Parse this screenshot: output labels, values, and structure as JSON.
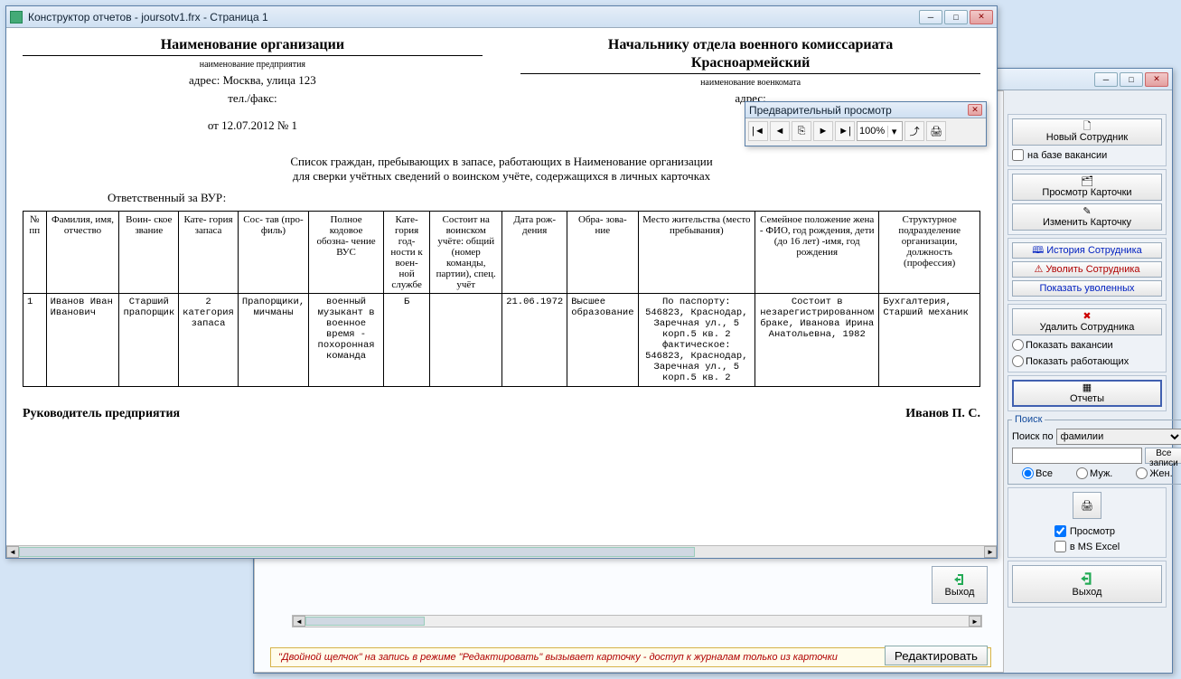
{
  "report_window": {
    "title": "Конструктор отчетов - joursotv1.frx - Страница 1",
    "org_heading": "Наименование организации",
    "org_note": "наименование предприятия",
    "org_addr": "адрес: Москва, улица 123",
    "org_tel": "тел./факс:",
    "org_date": "от 12.07.2012   № 1",
    "recip_heading": "Начальнику отдела военного комиссариата",
    "recip_name": "Красноармейский",
    "recip_note": "наименование военкомата",
    "recip_addr": "адрес:",
    "body_line1": "Список граждан, пребывающих в запасе, работающих в Наименование организации",
    "body_line2": "для сверки учётных сведений о воинском учёте, содержащихся в личных карточках",
    "resp_label": "Ответственный за ВУР:",
    "headers": {
      "c1": "№ пп",
      "c2": "Фамилия, имя, отчество",
      "c3": "Воин- ское звание",
      "c4": "Кате- гория запаса",
      "c5": "Сос- тав (про- филь)",
      "c6": "Полное кодовое обозна- чение ВУС",
      "c7": "Кате- гория год- ности к воен- ной службе",
      "c8": "Состоит на воинском учёте: общий (номер команды, партии), спец. учёт",
      "c9": "Дата рож- дения",
      "c10": "Обра- зова- ние",
      "c11": "Место жительства (место пребывания)",
      "c12": "Семейное положение жена - ФИО, год рождения, дети (до 16 лет) -имя, год рождения",
      "c13": "Структурное подразделение организации, должность (профессия)"
    },
    "row": {
      "c1": "1",
      "c2": "Иванов Иван Иванович",
      "c3": "Старший прапорщик",
      "c4": "2 категория запаса",
      "c5": "Прапорщики, мичманы",
      "c6": "военный музыкант в военное время - похоронная команда",
      "c7": "Б",
      "c8": "",
      "c9": "21.06.1972",
      "c10": "Высшее образование",
      "c11": "По паспорту: 546823, Краснодар, Заречная ул., 5 корп.5 кв. 2 фактическое: 546823, Краснодар, Заречная ул., 5 корп.5 кв. 2",
      "c12": "Состоит в незарегистрированном браке, Иванова Ирина Анатольевна, 1982",
      "c13": "Бухгалтерия, Старший механик"
    },
    "sign_left": "Руководитель предприятия",
    "sign_right": "Иванов П. С."
  },
  "preview_tb": {
    "title": "Предварительный просмотр",
    "zoom": "100%"
  },
  "bgwin": {
    "tip": "\"Двойной щелчок\" на запись в режиме \"Редактировать\" вызывает карточку  -  доступ к журналам только из карточки",
    "edit_btn": "Редактировать",
    "exit_btn": "Выход"
  },
  "side": {
    "new_emp": "Новый Сотрудник",
    "on_vacancy": "на базе вакансии",
    "view_card": "Просмотр Карточки",
    "edit_card": "Изменить Карточку",
    "history": "История Сотрудника",
    "fire": "Уволить Сотрудника",
    "show_fired": "Показать уволенных",
    "delete": "Удалить Сотрудника",
    "show_vac": "Показать вакансии",
    "show_work": "Показать работающих",
    "reports": "Отчеты",
    "search_legend": "Поиск",
    "search_by": "Поиск по",
    "search_field": "фамилии",
    "all_records": "Все записи",
    "r_all": "Все",
    "r_m": "Муж.",
    "r_f": "Жен.",
    "preview_chk": "Просмотр",
    "excel_chk": "в MS Excel",
    "exit": "Выход"
  }
}
